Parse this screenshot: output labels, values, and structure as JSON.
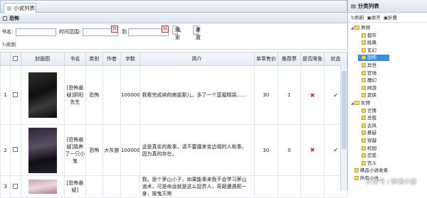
{
  "tabs": [
    {
      "label": "小说列表"
    }
  ],
  "panel": {
    "title": "恐怖"
  },
  "search": {
    "name_label": "书名:",
    "name_value": "",
    "time_label": "时间范围:",
    "to_label": "到",
    "search_button": "搜索",
    "reset_button": "重置"
  },
  "toolbar": {
    "refresh_label": "刷新"
  },
  "table": {
    "headers": [
      "",
      "",
      "封面图",
      "书名",
      "类别",
      "作者",
      "字数",
      "简介",
      "单章售价",
      "推荐票",
      "是否限免",
      "状态"
    ],
    "rows": [
      {
        "num": "1",
        "title": "[恐怖悬疑]阴阳先生",
        "category": "恐怖",
        "author": "",
        "words": "100000",
        "intro": "我看完成纳的病拔那儿，多了一个蓝猩精袋……",
        "price": "30",
        "votes": "1",
        "free": "✖",
        "status": "✔"
      },
      {
        "num": "2",
        "title": "[恐怖悬疑]我养了一只小鬼",
        "category": "恐怖",
        "author": "大灰狼",
        "words": "100000",
        "intro": "这是真实的故事，请不要擅来变边相的人和事，因为真的存在。",
        "price": "30",
        "votes": "0",
        "free": "✖",
        "status": "✔"
      },
      {
        "num": "3",
        "title": "[恐怖悬疑]",
        "category": "",
        "author": "",
        "words": "",
        "intro": "我，是个茅山小子，如果能事来我不会学习茅山道术，可是命运就是这么捉弄人，奇葩遭遇熙一身，按鬼灭煞",
        "price": "",
        "votes": "",
        "free": "",
        "status": ""
      }
    ]
  },
  "sidebar": {
    "title": "分类列表",
    "tools": {
      "refresh": "刷新",
      "expand": "展开",
      "collapse": "折叠"
    },
    "tree": [
      {
        "label": "男频",
        "level": 0,
        "type": "folder"
      },
      {
        "label": "都市",
        "level": 1,
        "type": "file"
      },
      {
        "label": "经典",
        "level": 1,
        "type": "file"
      },
      {
        "label": "玄幻",
        "level": 1,
        "type": "file"
      },
      {
        "label": "恐怖",
        "level": 1,
        "type": "file",
        "selected": true
      },
      {
        "label": "异世",
        "level": 1,
        "type": "file"
      },
      {
        "label": "官场",
        "level": 1,
        "type": "file"
      },
      {
        "label": "魔幻",
        "level": 1,
        "type": "file"
      },
      {
        "label": "网游",
        "level": 1,
        "type": "file"
      },
      {
        "label": "武侠",
        "level": 1,
        "type": "file"
      },
      {
        "label": "女频",
        "level": 0,
        "type": "folder"
      },
      {
        "label": "言情",
        "level": 1,
        "type": "file"
      },
      {
        "label": "总裁",
        "level": 1,
        "type": "file"
      },
      {
        "label": "古风",
        "level": 1,
        "type": "file"
      },
      {
        "label": "悬疑",
        "level": 1,
        "type": "file"
      },
      {
        "label": "穿越",
        "level": 1,
        "type": "file"
      },
      {
        "label": "校园",
        "level": 1,
        "type": "file"
      },
      {
        "label": "恋爱",
        "level": 1,
        "type": "file"
      },
      {
        "label": "宫斗",
        "level": 1,
        "type": "file"
      },
      {
        "label": "精品小说收录",
        "level": 0,
        "type": "file"
      },
      {
        "label": "所有小说",
        "level": 0,
        "type": "file"
      }
    ]
  },
  "watermark": "头条号 / 醉话小酋",
  "colors": {
    "selected": "#3b8de0",
    "accent_red": "#d22222",
    "status_green": "#2a8a2a"
  }
}
